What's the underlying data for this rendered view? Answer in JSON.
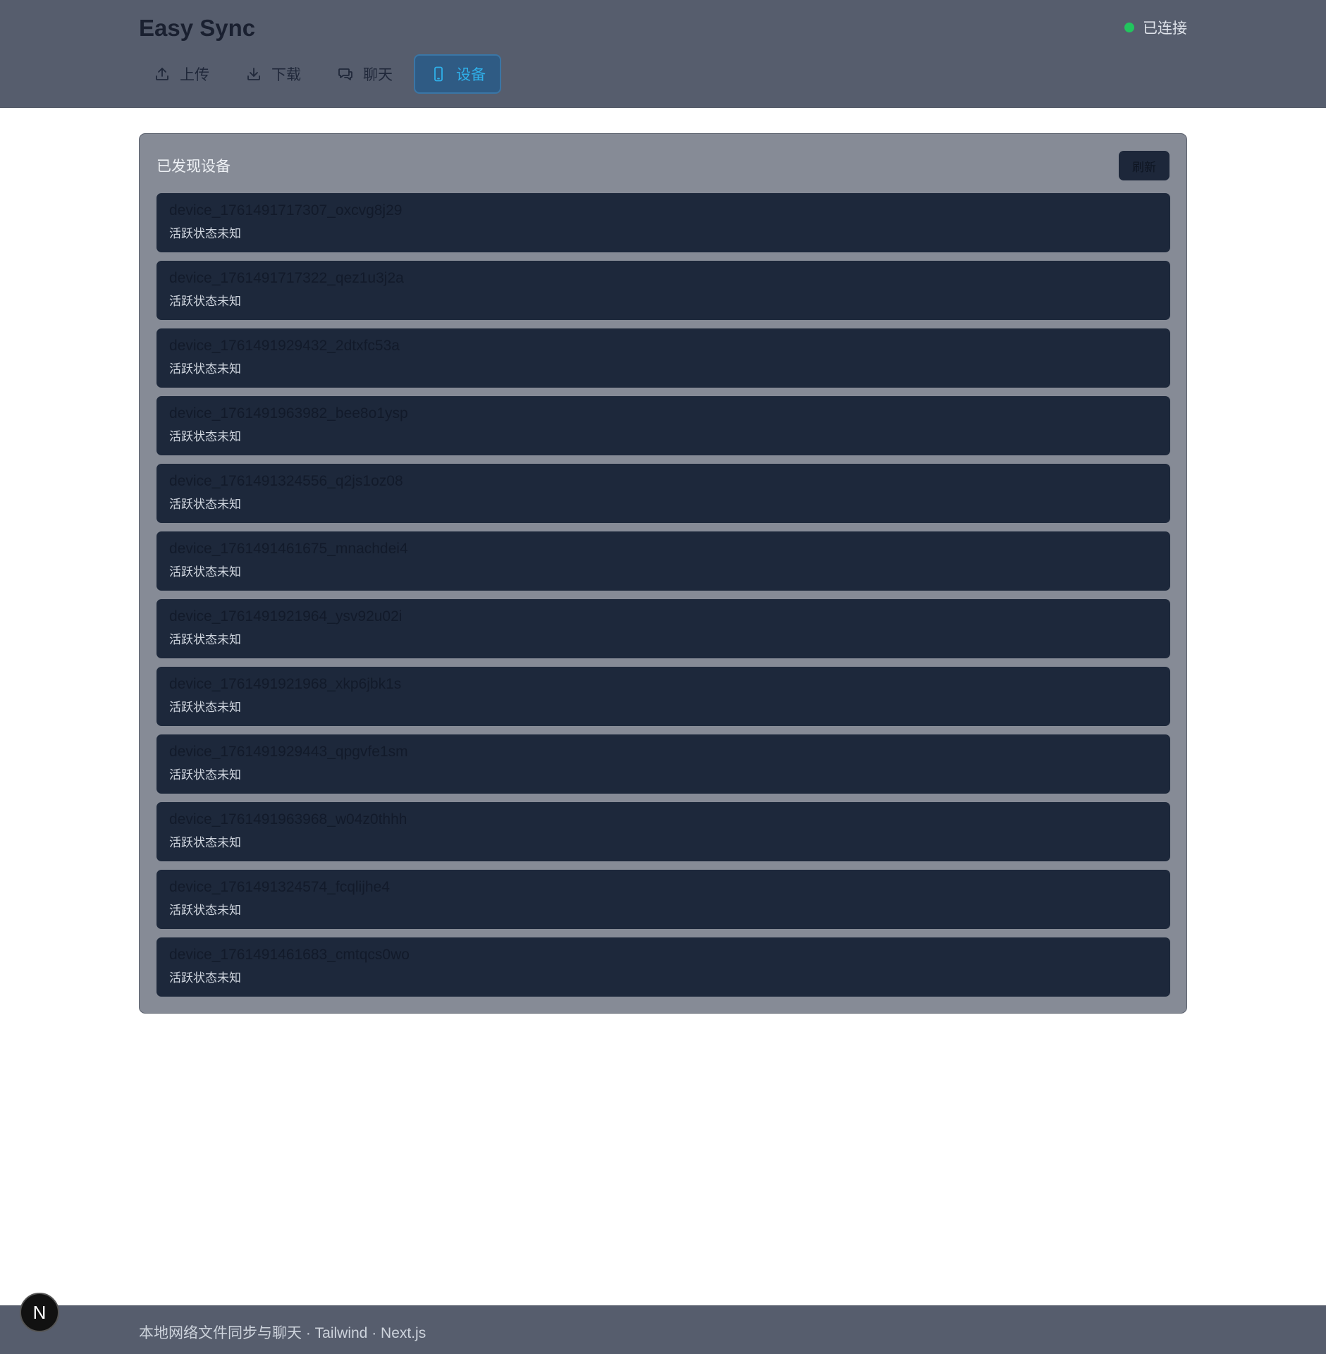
{
  "header": {
    "title": "Easy Sync",
    "status_text": "已连接",
    "status_color": "#22c55e",
    "tabs": [
      {
        "label": "上传",
        "icon": "upload-icon",
        "active": false
      },
      {
        "label": "下载",
        "icon": "download-icon",
        "active": false
      },
      {
        "label": "聊天",
        "icon": "chat-icon",
        "active": false
      },
      {
        "label": "设备",
        "icon": "device-icon",
        "active": true
      }
    ]
  },
  "panel": {
    "title": "已发现设备",
    "refresh_label": "刷新",
    "devices": [
      {
        "name": "device_1761491717307_oxcvg8j29",
        "status": "活跃状态未知"
      },
      {
        "name": "device_1761491717322_qez1u3j2a",
        "status": "活跃状态未知"
      },
      {
        "name": "device_1761491929432_2dtxfc53a",
        "status": "活跃状态未知"
      },
      {
        "name": "device_1761491963982_bee8o1ysp",
        "status": "活跃状态未知"
      },
      {
        "name": "device_1761491324556_q2js1oz08",
        "status": "活跃状态未知"
      },
      {
        "name": "device_1761491461675_mnachdei4",
        "status": "活跃状态未知"
      },
      {
        "name": "device_1761491921964_ysv92u02i",
        "status": "活跃状态未知"
      },
      {
        "name": "device_1761491921968_xkp6jbk1s",
        "status": "活跃状态未知"
      },
      {
        "name": "device_1761491929443_qpgvfe1sm",
        "status": "活跃状态未知"
      },
      {
        "name": "device_1761491963968_w04z0thhh",
        "status": "活跃状态未知"
      },
      {
        "name": "device_1761491324574_fcqlijhe4",
        "status": "活跃状态未知"
      },
      {
        "name": "device_1761491461683_cmtqcs0wo",
        "status": "活跃状态未知"
      }
    ]
  },
  "footer": {
    "text": "本地网络文件同步与聊天 · Tailwind · Next.js",
    "badge_letter": "N"
  }
}
